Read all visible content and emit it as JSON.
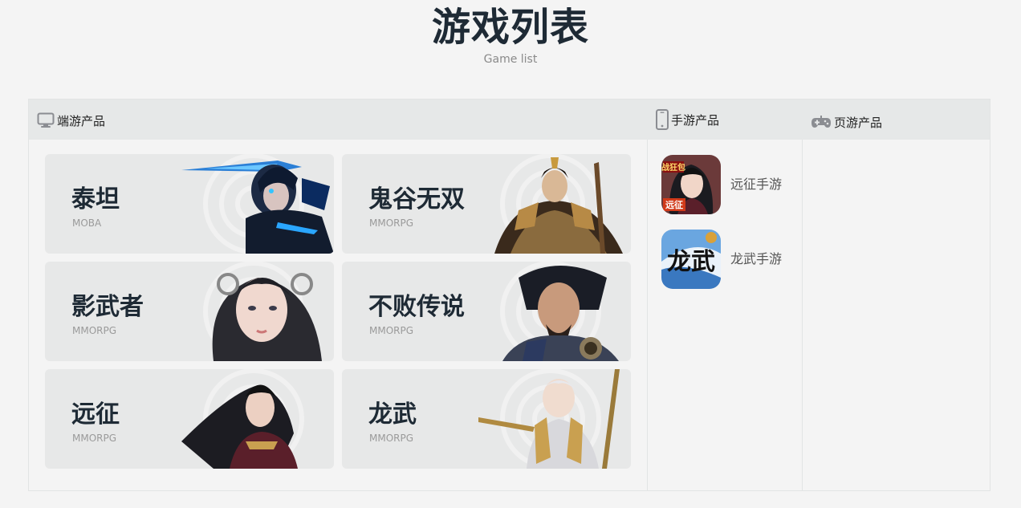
{
  "header": {
    "title": "游戏列表",
    "subtitle": "Game list"
  },
  "tabs": {
    "pc": {
      "label": "端游产品",
      "icon": "monitor-icon"
    },
    "mobile": {
      "label": "手游产品",
      "icon": "smartphone-icon"
    },
    "web": {
      "label": "页游产品",
      "icon": "gamepad-icon"
    }
  },
  "pc_games": [
    {
      "name": "泰坦",
      "genre": "MOBA"
    },
    {
      "name": "鬼谷无双",
      "genre": "MMORPG"
    },
    {
      "name": "影武者",
      "genre": "MMORPG"
    },
    {
      "name": "不败传说",
      "genre": "MMORPG"
    },
    {
      "name": "远征",
      "genre": "MMORPG"
    },
    {
      "name": "龙武",
      "genre": "MMORPG"
    }
  ],
  "mobile_games": [
    {
      "name": "远征手游",
      "icon_badge": "战狂包",
      "icon_tag": "远征"
    },
    {
      "name": "龙武手游",
      "icon_calligraphy": "龙武"
    }
  ],
  "colors": {
    "background": "#f4f4f4",
    "tabbar": "#e6e8e8",
    "card": "#e7e8e8",
    "title": "#1e2a35",
    "muted": "#9a9a9a"
  }
}
